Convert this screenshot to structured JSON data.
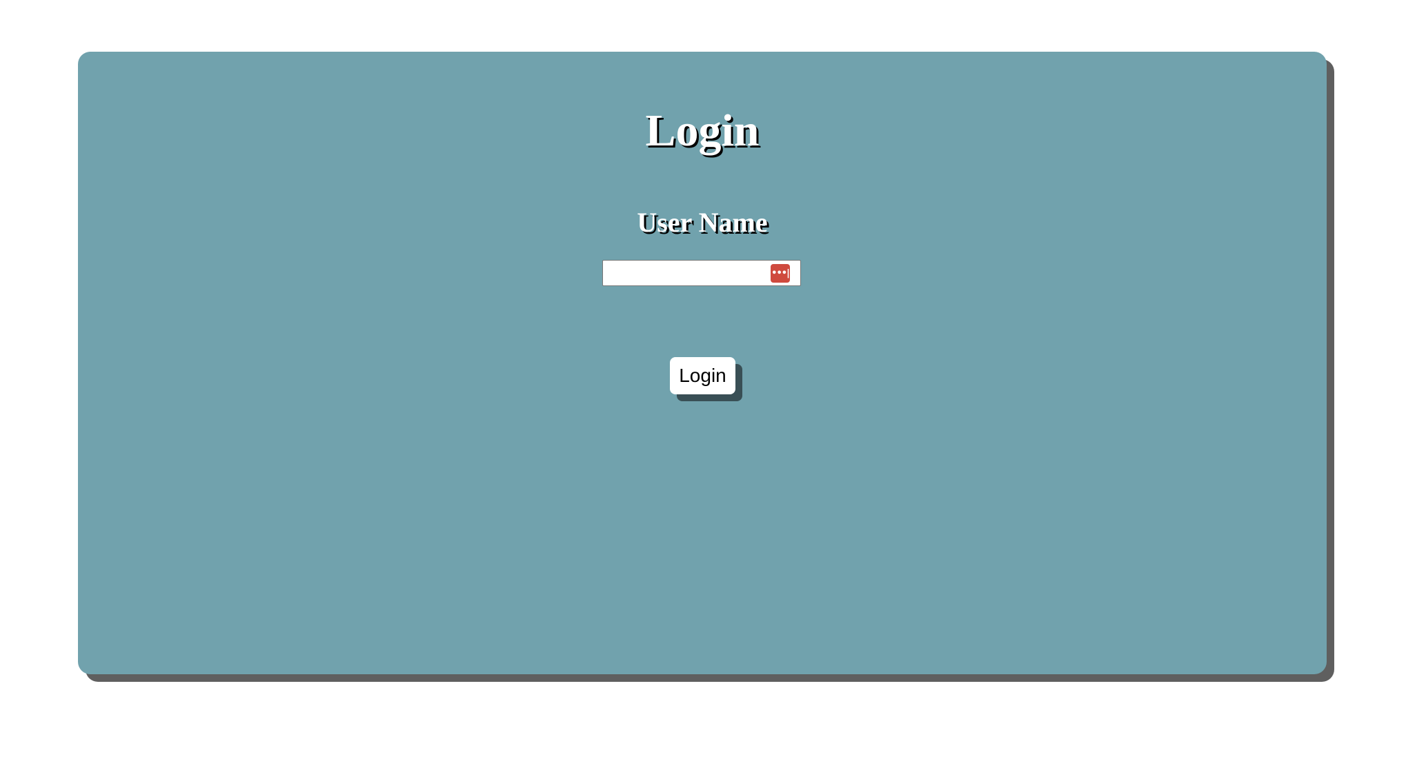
{
  "page": {
    "title": "Login"
  },
  "form": {
    "username_label": "User Name",
    "username_value": "",
    "username_placeholder": "",
    "password_manager_icon": "password-manager-dots-icon",
    "password_manager_glyph": "•••|",
    "submit_label": "Login"
  },
  "colors": {
    "background": "#ffffff",
    "card": "#71a2ad",
    "card_shadow": "#5f5f5f",
    "button_shadow": "#394f55",
    "icon_badge": "#cf4a3e",
    "text": "#ffffff"
  }
}
